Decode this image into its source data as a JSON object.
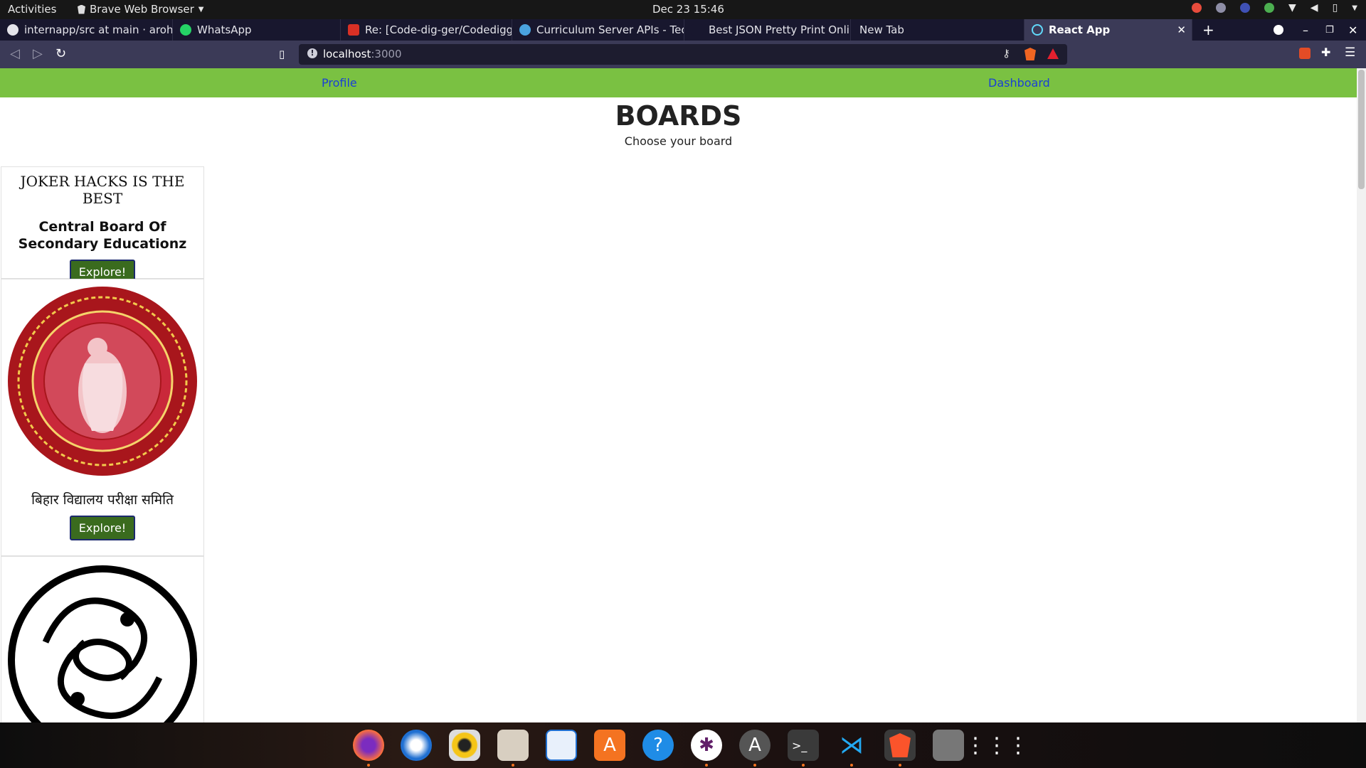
{
  "system": {
    "activities": "Activities",
    "app_menu": "Brave Web Browser",
    "clock": "Dec 23  15:46"
  },
  "tabs": [
    {
      "title": "internapp/src at main · arohia",
      "favicon_color": "#e4e4ea"
    },
    {
      "title": "WhatsApp",
      "favicon_color": "#25d366"
    },
    {
      "title": "Re: [Code-dig-ger/Codedigger",
      "favicon_color": "#d93025"
    },
    {
      "title": "Curriculum Server APIs - Techn",
      "favicon_color": "#4aa3df"
    },
    {
      "title": "Best JSON Pretty Print Online",
      "favicon_color": "#18172e"
    },
    {
      "title": "New Tab",
      "favicon_color": "#18172e"
    },
    {
      "title": "React App",
      "favicon_color": "#61dafb"
    }
  ],
  "address_bar": {
    "host": "localhost",
    "port": ":3000"
  },
  "navbar": {
    "profile": "Profile",
    "dashboard": "Dashboard"
  },
  "page": {
    "heading": "BOARDS",
    "subheading": "Choose your board"
  },
  "cards": [
    {
      "logo_text": "JOKER HACKS IS THE BEST",
      "name": "Central Board Of Secondary Educationz",
      "button": "Explore!"
    },
    {
      "logo_image": "bihar-board-seal",
      "logo_text": "",
      "name": "बिहार विद्यालय परीक्षा समिति",
      "button": "Explore!"
    },
    {
      "logo_image": "swan-emblem",
      "logo_text": "",
      "name": "",
      "button": ""
    }
  ],
  "colors": {
    "navbar": "#7ac142",
    "button": "#3a6b1e",
    "link": "#1a3fd6"
  }
}
